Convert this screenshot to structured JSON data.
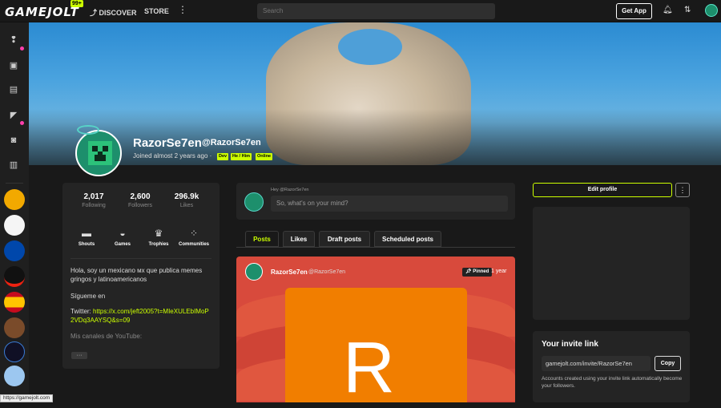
{
  "topbar": {
    "logo": "GAMEJOLT",
    "logo_badge": "99+",
    "discover": "DISCOVER",
    "store": "STORE",
    "more": "⋮",
    "search_placeholder": "Search",
    "get_app": "Get App"
  },
  "profile": {
    "display_name": "RazorSe7en",
    "handle": "@RazorSe7en",
    "joined": "Joined almost 2 years ago",
    "badges": [
      "Dev",
      "He / Him",
      "Online"
    ]
  },
  "stats": [
    {
      "value": "2,017",
      "label": "Following"
    },
    {
      "value": "2,600",
      "label": "Followers"
    },
    {
      "value": "296.9k",
      "label": "Likes"
    }
  ],
  "quick_links": [
    {
      "label": "Shouts",
      "icon": "shouts-icon"
    },
    {
      "label": "Games",
      "icon": "gamepad-icon"
    },
    {
      "label": "Trophies",
      "icon": "trophy-icon"
    },
    {
      "label": "Communities",
      "icon": "communities-icon"
    }
  ],
  "bio": {
    "line1": "Hola, soy un mexicano ᴍx que publica memes gringos y latinoamericanos",
    "line2": "Sígueme en",
    "twitter_label": "Twitter: ",
    "twitter_link": "https://x.com/jeft2005?t=MIeXULEbIMoP2VDq3AAYSQ&s=09",
    "line3": "Mis canales de YouTube:",
    "more": "···"
  },
  "composer": {
    "hey": "Hey @RazorSe7en",
    "placeholder": "So, what's on your mind?"
  },
  "tabs": [
    "Posts",
    "Likes",
    "Draft posts",
    "Scheduled posts"
  ],
  "post": {
    "user": "RazorSe7en",
    "handle": "@RazorSe7en",
    "pinned": "Pinned",
    "age": "1 year",
    "image_letter": "R"
  },
  "sidebar_right": {
    "edit_profile": "Edit profile",
    "more": "⋮",
    "invite_title": "Your invite link",
    "invite_url": "gamejolt.com/invite/RazorSe7en",
    "copy": "Copy",
    "invite_note": "Accounts created using your invite link automatically become your followers."
  },
  "statusbar": "https://gamejolt.com",
  "colors": {
    "accent": "#ccff00",
    "notify": "#ff3fac",
    "post_bg": "#d84a3c",
    "orange": "#f17e00"
  }
}
